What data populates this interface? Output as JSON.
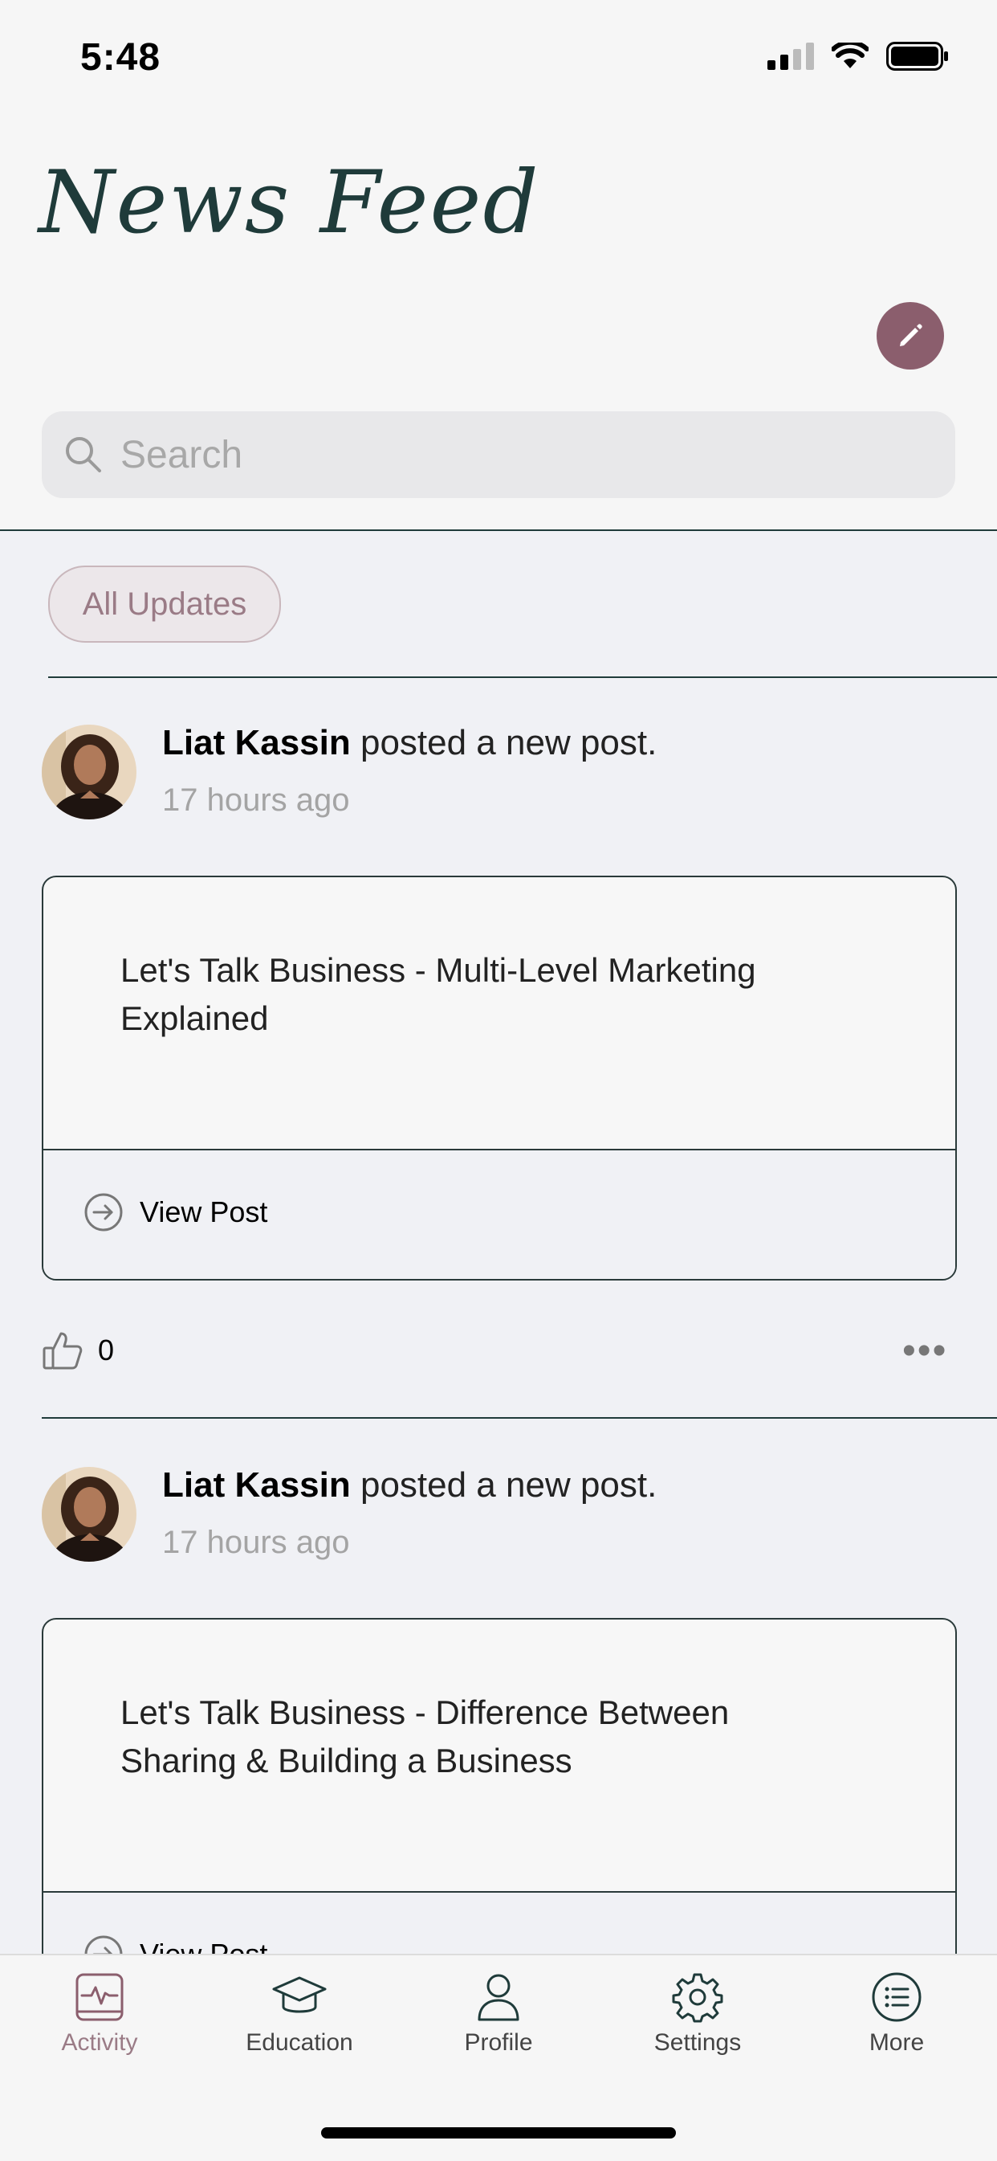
{
  "status_bar": {
    "time": "5:48"
  },
  "header": {
    "title": "News Feed",
    "search_placeholder": "Search"
  },
  "filter": {
    "label": "All Updates"
  },
  "posts": [
    {
      "author": "Liat Kassin",
      "action": " posted a new post.",
      "time": "17 hours ago",
      "card_text": "Let's Talk Business - Multi-Level Marketing Explained",
      "view_label": "View Post",
      "likes": "0"
    },
    {
      "author": "Liat Kassin",
      "action": " posted a new post.",
      "time": "17 hours ago",
      "card_text": "Let's Talk Business - Difference Between Sharing & Building a Business",
      "view_label": "View Post"
    }
  ],
  "tabs": [
    {
      "label": "Activity",
      "icon": "activity-icon",
      "active": true
    },
    {
      "label": "Education",
      "icon": "graduation-cap-icon"
    },
    {
      "label": "Profile",
      "icon": "profile-icon"
    },
    {
      "label": "Settings",
      "icon": "gear-icon"
    },
    {
      "label": "More",
      "icon": "list-icon"
    }
  ],
  "colors": {
    "accent": "#8b5e6d",
    "title": "#1f3b3a",
    "background": "#f0f1f5"
  }
}
